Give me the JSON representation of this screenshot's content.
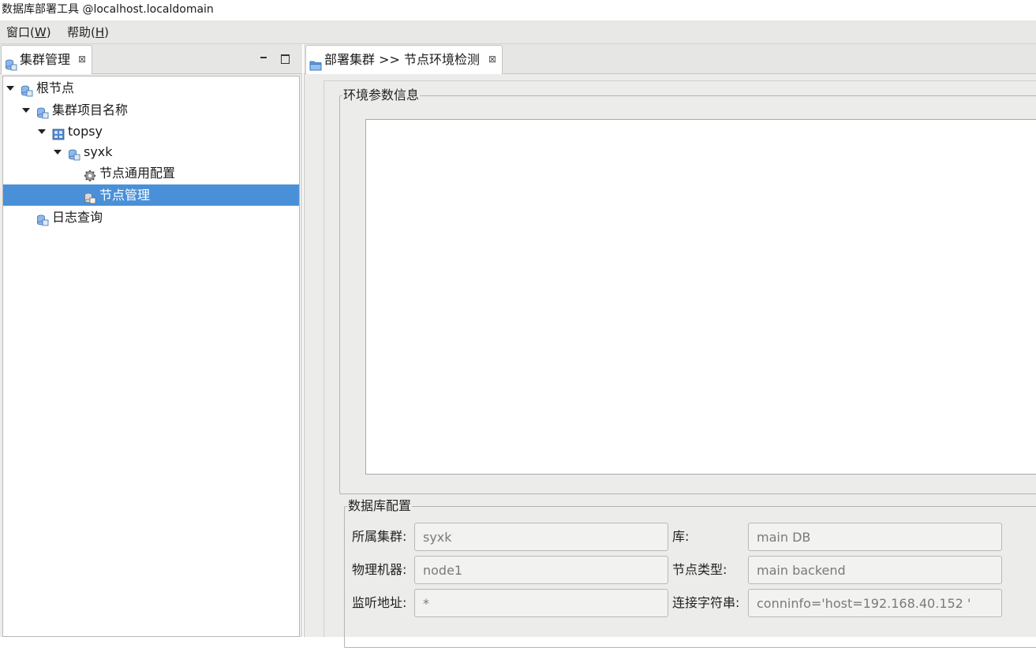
{
  "window": {
    "title": "数据库部署工具 @localhost.localdomain"
  },
  "menubar": {
    "items": [
      {
        "label": "窗口(",
        "mnemonic": "W",
        "suffix": ")"
      },
      {
        "label": "帮助(",
        "mnemonic": "H",
        "suffix": ")"
      }
    ]
  },
  "left_panel": {
    "tab_label": "集群管理",
    "tab_close": "⊠",
    "tree": [
      {
        "label": "根节点",
        "icon": "db-icon",
        "expanded": true
      },
      {
        "label": "集群项目名称",
        "icon": "db-icon",
        "expanded": true
      },
      {
        "label": "topsy",
        "icon": "server-icon",
        "expanded": true
      },
      {
        "label": "syxk",
        "icon": "db-icon",
        "expanded": true
      },
      {
        "label": "节点通用配置",
        "icon": "gear-icon"
      },
      {
        "label": "节点管理",
        "icon": "node-icon",
        "selected": true
      },
      {
        "label": "日志查询",
        "icon": "db-icon"
      }
    ]
  },
  "editor": {
    "tab_label": "部署集群 >> 节点环境检测",
    "tab_close": "⊠",
    "env_group_title": "环境参数信息",
    "db_group_title": "数据库配置",
    "fields": {
      "cluster_label": "所属集群:",
      "cluster_value": "syxk",
      "db_label": "库:",
      "db_value": "main DB",
      "machine_label": "物理机器:",
      "machine_value": "node1",
      "node_type_label": "节点类型:",
      "node_type_value": "main backend",
      "listen_label": "监听地址:",
      "listen_value": "*",
      "conn_label": "连接字符串:",
      "conn_value": "conninfo='host=192.168.40.152 '"
    }
  },
  "colors": {
    "selection": "#4a90d9",
    "menubar_bg": "#e8e8e7",
    "panel_bg": "#ececeb"
  }
}
